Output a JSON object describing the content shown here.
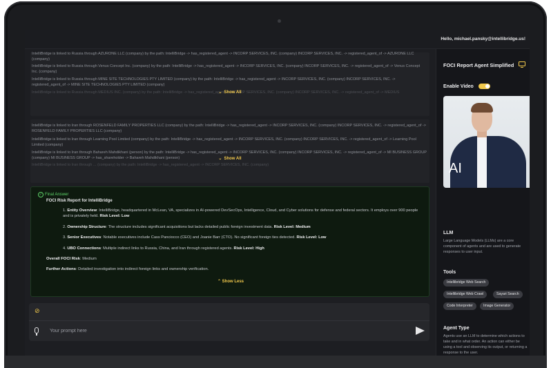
{
  "header": {
    "greeting": "Hello, michael.pansky@intellibridge.us!"
  },
  "results_block_1": {
    "lines": [
      "IntelliBridge is linked to Russia through AZURONE LLC (company) by the path: IntelliBridge -> has_registered_agent -> INCORP SERVICES, INC. (company) INCORP SERVICES, INC. -> registered_agent_of -> AZURONE LLC (company)",
      "IntelliBridge is linked to Russia through Venus Concept Inc. (company) by the path: IntelliBridge -> has_registered_agent -> INCORP SERVICES, INC. (company) INCORP SERVICES, INC. -> registered_agent_of -> Venus Concept Inc. (company)",
      "IntelliBridge is linked to Russia through MINE SITE TECHNOLOGIES PTY LIMITED (company) by the path: IntelliBridge -> has_registered_agent -> INCORP SERVICES, INC. (company) INCORP SERVICES, INC. -> registered_agent_of -> MINE SITE TECHNOLOGIES PTY LIMITED (company)",
      "IntelliBridge is linked to Russia through MEDIUS INC. (company) by the path: IntelliBridge -> has_registered_agent -> INCORP SERVICES, INC. (company) INCORP SERVICES, INC. -> registered_agent_of -> MEDIUS"
    ],
    "show_all": "Show All"
  },
  "results_block_2": {
    "lines": [
      "IntelliBridge is linked to Iran through ROSENFELD FAMILY PROPERTIES LLC (company) by the path: IntelliBridge -> has_registered_agent -> INCORP SERVICES, INC. (company) INCORP SERVICES, INC. -> registered_agent_of -> ROSENFELD FAMILY PROPERTIES LLC (company)",
      "IntelliBridge is linked to Iran through Learning Pool Limited (company) by the path: IntelliBridge -> has_registered_agent -> INCORP SERVICES, INC. (company) INCORP SERVICES, INC. -> registered_agent_of -> Learning Pool Limited (company)",
      "IntelliBridge is linked to Iran through Bahareh Mahdikhani (person) by the path: IntelliBridge -> has_registered_agent -> INCORP SERVICES, INC. (company) INCORP SERVICES, INC. -> registered_agent_of -> MI BUSINESS GROUP (company) MI BUSINESS GROUP -> has_shareholder -> Bahareh Mahdikhani (person)",
      "IntelliBridge is linked to Iran through ... (company) by the path: IntelliBridge -> has_registered_agent -> INCORP SERVICES, INC. (company)"
    ],
    "show_all": "Show All"
  },
  "final_answer": {
    "label": "Final Answer",
    "title": "FOCI Risk Report for IntelliBridge",
    "items": [
      {
        "num": "1.",
        "heading": "Entity Overview",
        "text": ": IntelliBridge, headquartered in McLean, VA, specializes in AI-powered DevSecOps, Intelligence, Cloud, and Cyber solutions for defense and federal sectors. It employs over 900 people and is privately held. ",
        "risk": "Risk Level: Low"
      },
      {
        "num": "2.",
        "heading": "Ownership Structure",
        "text": ": The structure includes significant acquisitions but lacks detailed public foreign investment data. ",
        "risk": "Risk Level: Medium"
      },
      {
        "num": "3.",
        "heading": "Senior Executives",
        "text": ": Notable executives include Cass Panciocco (CEO) and Joanie Barr (CTO). No significant foreign ties detected. ",
        "risk": "Risk Level: Low"
      },
      {
        "num": "4.",
        "heading": "UBO Connections",
        "text": ": Multiple indirect links to Russia, China, and Iran through registered agents. ",
        "risk": "Risk Level: High"
      }
    ],
    "overall_label": "Overall FOCI Risk",
    "overall_value": ": Medium",
    "further_label": "Further Actions",
    "further_value": ": Detailed investigation into indirect foreign links and ownership verification.",
    "show_less": "Show Less"
  },
  "composer": {
    "placeholder": "Your prompt here",
    "attach_icon": "paperclip-icon",
    "mic_icon": "microphone-icon",
    "send_icon": "send-icon"
  },
  "panel": {
    "agent_title": "FOCI Report Agent Simplified",
    "enable_video": "Enable Video",
    "video_enabled": true,
    "avatar_text": "AI",
    "llm_title": "LLM",
    "llm_text": "Large Language Models (LLMs) are a core component of agents and are used to generate responses to user input.",
    "tools_title": "Tools",
    "tools": [
      "Intellibridge Web Search",
      "Intellibridge Web Crawl",
      "Sayari Search",
      "Code Interpreter",
      "Image Generator"
    ],
    "agent_type_title": "Agent Type",
    "agent_type_text": "Agents use an LLM to determine which actions to take and in what order. An action can either be using a tool and observing its output, or returning a response to the user."
  },
  "colors": {
    "accent": "#f2c94c",
    "success": "#5fd46a",
    "background": "#17181b"
  }
}
